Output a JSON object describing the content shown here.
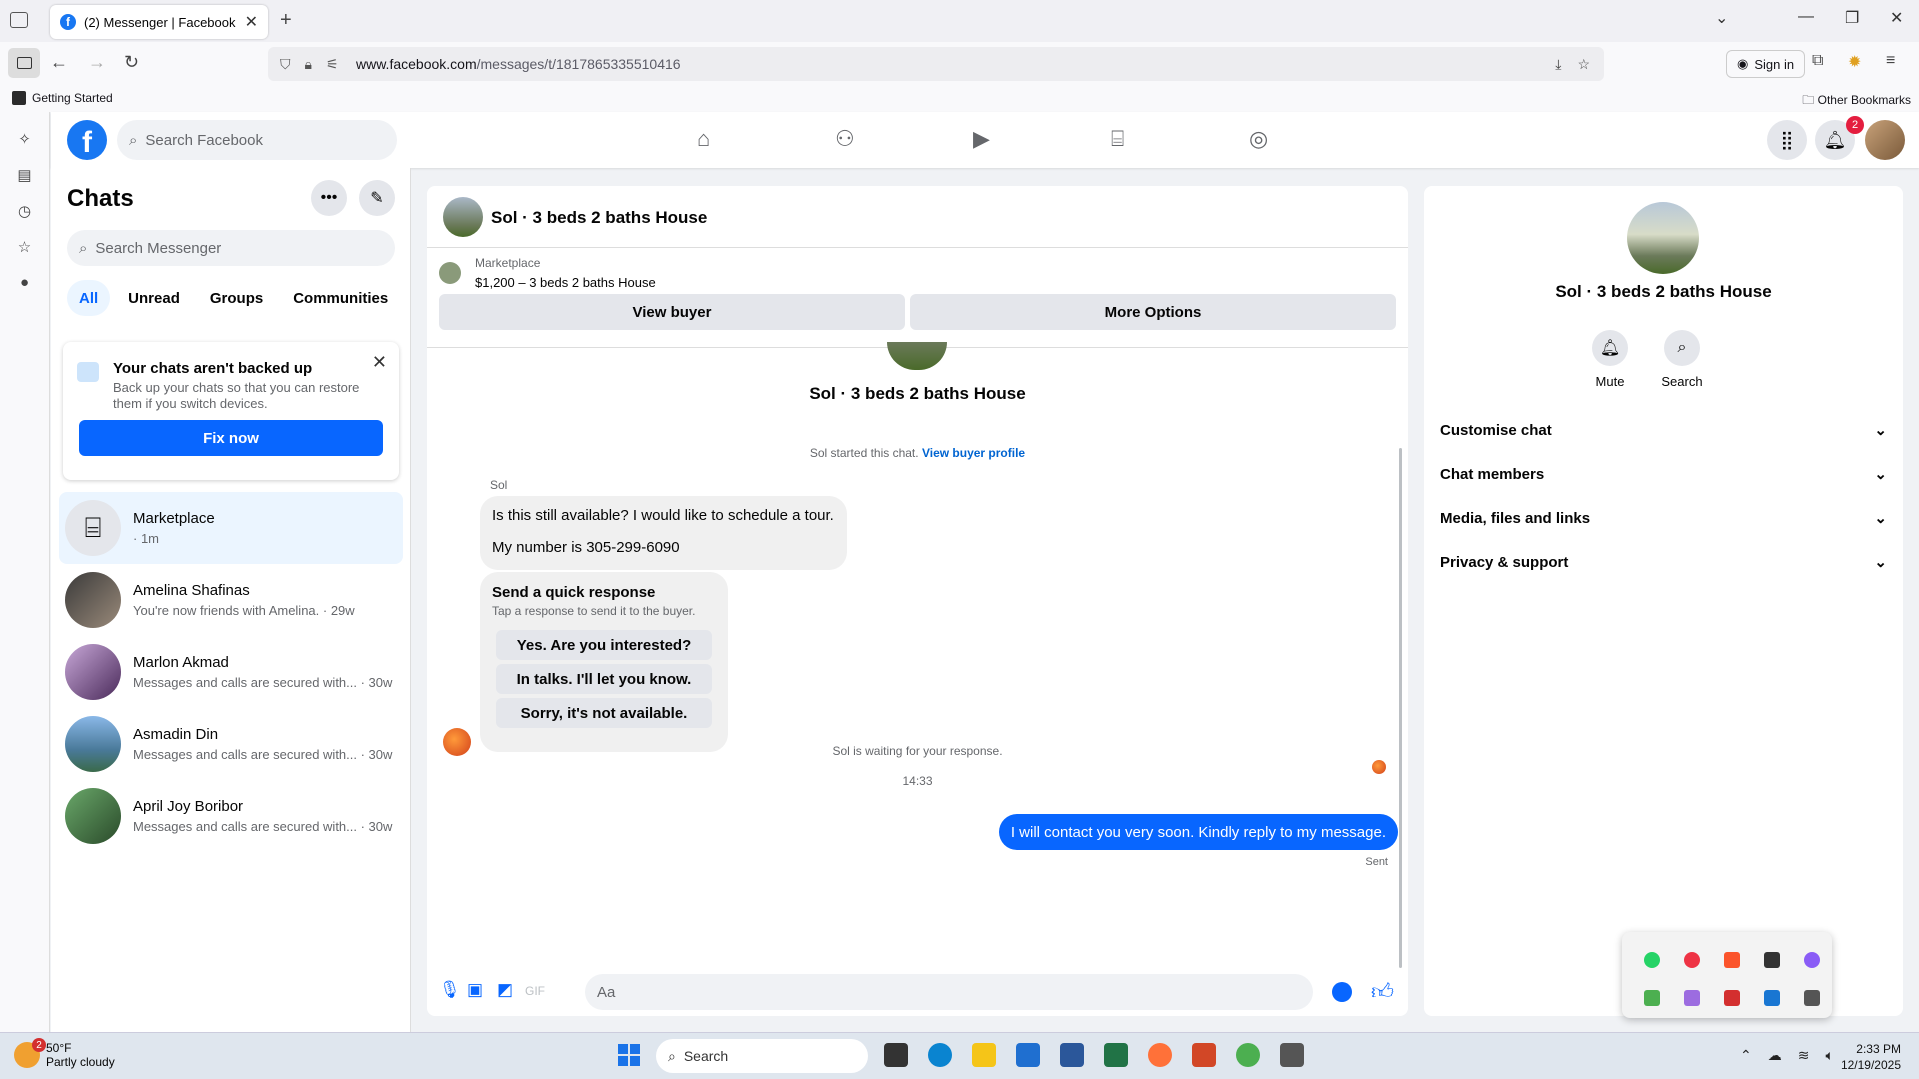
{
  "browser": {
    "tab_title": "(2) Messenger | Facebook",
    "url_domain": "www.facebook.com",
    "url_path": "/messages/t/1817865335510416",
    "sign_in": "Sign in",
    "bookmark_getting_started": "Getting Started",
    "bookmark_other": "Other Bookmarks"
  },
  "fb": {
    "search_placeholder": "Search Facebook",
    "notification_count": "2"
  },
  "chats": {
    "title": "Chats",
    "search_placeholder": "Search Messenger",
    "filters": [
      "All",
      "Unread",
      "Groups",
      "Communities"
    ],
    "backup": {
      "title": "Your chats aren't backed up",
      "desc": "Back up your chats so that you can restore them if you switch devices.",
      "button": "Fix now"
    },
    "list": [
      {
        "name": "Marketplace",
        "preview": "· 1m"
      },
      {
        "name": "Amelina Shafinas",
        "preview": "You're now friends with Amelina. · 29w"
      },
      {
        "name": "Marlon Akmad",
        "preview": "Messages and calls are secured with... · 30w"
      },
      {
        "name": "Asmadin Din",
        "preview": "Messages and calls are secured with... · 30w"
      },
      {
        "name": "April Joy Boribor",
        "preview": "Messages and calls are secured with... · 30w"
      }
    ]
  },
  "conversation": {
    "title": "Sol · 3 beds 2 baths House",
    "marketplace_label": "Marketplace",
    "listing": "$1,200 – 3 beds 2 baths House",
    "view_buyer": "View buyer",
    "more_options": "More Options",
    "thread_name": "Sol · 3 beds 2 baths House",
    "started_text": "Sol started this chat.",
    "view_buyer_profile": "View buyer profile",
    "sender": "Sol",
    "message_line1": "Is this still available? I would like to schedule a tour.",
    "message_line2": "My number is 305-299-6090",
    "quick_title": "Send a quick response",
    "quick_sub": "Tap a response to send it to the buyer.",
    "quick_options": [
      "Yes. Are you interested?",
      "In talks. I'll let you know.",
      "Sorry, it's not available."
    ],
    "waiting": "Sol is waiting for your response.",
    "time": "14:33",
    "my_message": "I will contact you very soon. Kindly reply to my message.",
    "sent": "Sent",
    "composer_placeholder": "Aa"
  },
  "info_panel": {
    "name": "Sol · 3 beds 2 baths House",
    "mute": "Mute",
    "search": "Search",
    "sections": [
      "Customise chat",
      "Chat members",
      "Media, files and links",
      "Privacy & support"
    ]
  },
  "taskbar": {
    "temp": "50°F",
    "weather": "Partly cloudy",
    "weather_badge": "2",
    "search": "Search",
    "time": "2:33 PM",
    "date": "12/19/2025"
  }
}
